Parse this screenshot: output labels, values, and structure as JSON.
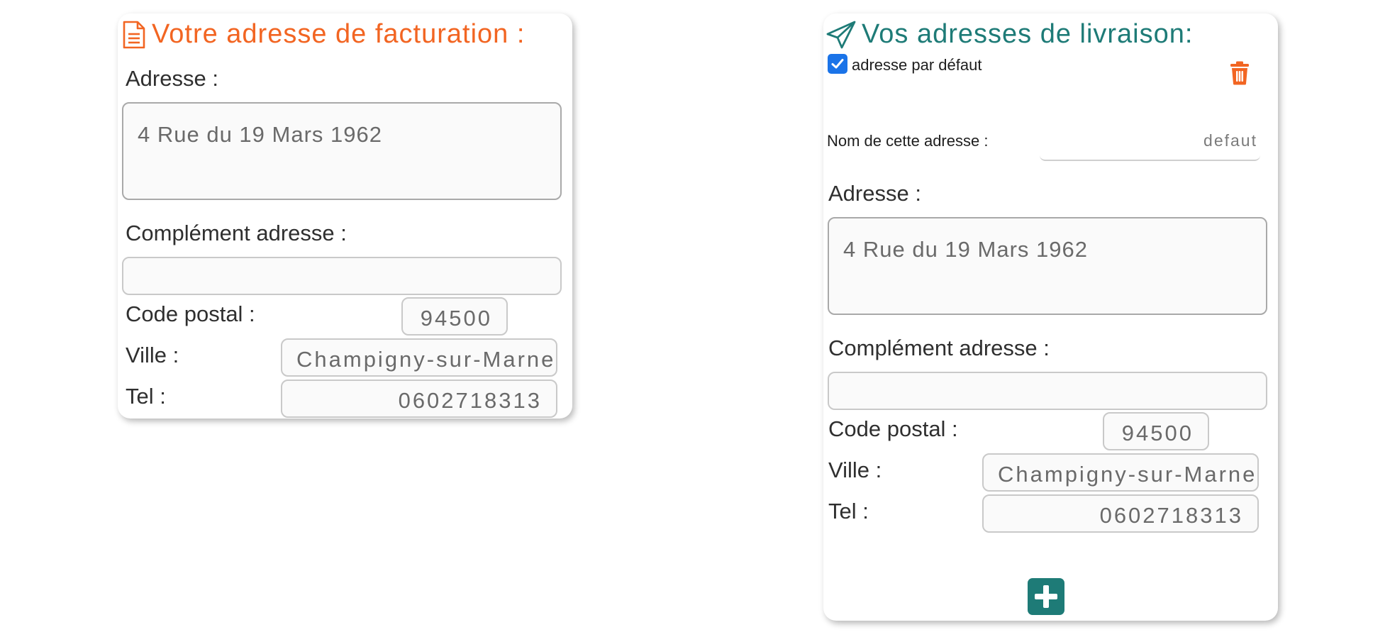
{
  "colors": {
    "billing_accent": "#f26522",
    "delivery_accent": "#1e7b77",
    "trash_color": "#f26522",
    "check_color": "#1a73e8"
  },
  "billing": {
    "icon": "document-icon",
    "title": "Votre adresse de facturation :",
    "address_label": "Adresse :",
    "address_value": "4 Rue du 19 Mars 1962",
    "complement_label": "Complément adresse :",
    "complement_value": "",
    "postal_label": "Code postal :",
    "postal_value": "94500",
    "city_label": "Ville :",
    "city_value": "Champigny-sur-Marne",
    "tel_label": "Tel :",
    "tel_value": "0602718313"
  },
  "delivery": {
    "icon": "paper-plane-icon",
    "title": "Vos adresses de livraison:",
    "default_checkbox_label": "adresse par défaut",
    "default_checked": true,
    "delete_icon": "trash-icon",
    "name_label": "Nom de cette adresse :",
    "name_value": "defaut",
    "address_label": "Adresse :",
    "address_value": "4 Rue du 19 Mars 1962",
    "complement_label": "Complément adresse :",
    "complement_value": "",
    "postal_label": "Code postal :",
    "postal_value": "94500",
    "city_label": "Ville :",
    "city_value": "Champigny-sur-Marne",
    "tel_label": "Tel :",
    "tel_value": "0602718313",
    "add_icon": "plus-icon"
  }
}
